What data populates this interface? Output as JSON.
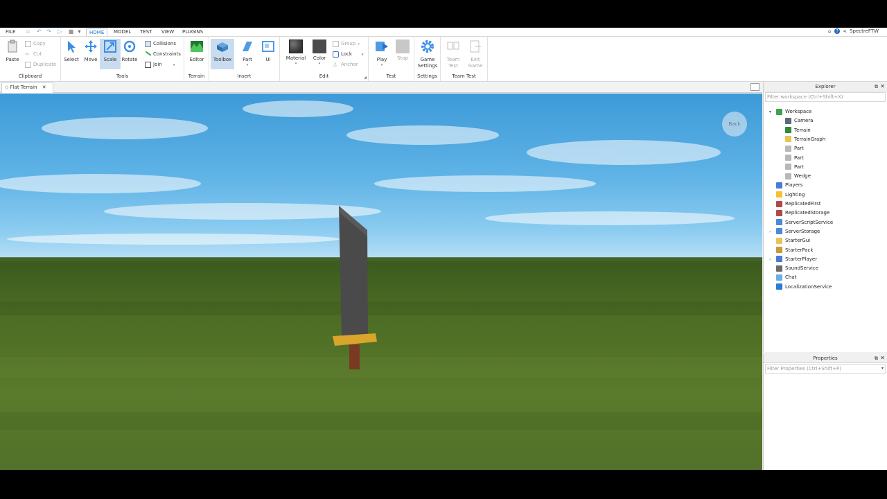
{
  "menu": {
    "tabs": [
      "FILE",
      "HOME",
      "MODEL",
      "TEST",
      "VIEW",
      "PLUGINS"
    ],
    "active_tab": "HOME",
    "user": "SpectreFTW"
  },
  "ribbon": {
    "clipboard": {
      "label": "Clipboard",
      "paste": "Paste",
      "copy": "Copy",
      "cut": "Cut",
      "duplicate": "Duplicate"
    },
    "tools": {
      "label": "Tools",
      "select": "Select",
      "move": "Move",
      "scale": "Scale",
      "rotate": "Rotate",
      "collisions": "Collisions",
      "constraints": "Constraints",
      "join": "Join"
    },
    "terrain": {
      "label": "Terrain",
      "editor": "Editor"
    },
    "insert": {
      "label": "Insert",
      "toolbox": "Toolbox",
      "part": "Part",
      "ui": "UI"
    },
    "edit": {
      "label": "Edit",
      "material": "Material",
      "color": "Color",
      "group": "Group",
      "lock": "Lock",
      "anchor": "Anchor"
    },
    "test": {
      "label": "Test",
      "play": "Play",
      "stop": "Stop"
    },
    "settings": {
      "label": "Settings",
      "game_settings_1": "Game",
      "game_settings_2": "Settings"
    },
    "team_test": {
      "label": "Team Test",
      "team_1": "Team",
      "team_2": "Test",
      "exit_1": "Exit",
      "exit_2": "Game"
    }
  },
  "document_tab": {
    "title": "Flat Terrain",
    "close": "✕"
  },
  "viewport": {
    "back_label": "Back"
  },
  "explorer": {
    "title": "Explorer",
    "filter_placeholder": "Filter workspace (Ctrl+Shift+X)",
    "items": [
      {
        "label": "Workspace",
        "icon": "workspace-icon",
        "color": "#3aa54a"
      },
      {
        "label": "Camera",
        "icon": "camera-icon",
        "color": "#5a6b7a"
      },
      {
        "label": "Terrain",
        "icon": "terrain-icon",
        "color": "#2e8b3a"
      },
      {
        "label": "TerrainGraph",
        "icon": "folder-icon",
        "color": "#e8c35a"
      },
      {
        "label": "Part",
        "icon": "part-icon",
        "color": "#b8b8b8"
      },
      {
        "label": "Part",
        "icon": "part-icon",
        "color": "#b8b8b8"
      },
      {
        "label": "Part",
        "icon": "part-icon",
        "color": "#b8b8b8"
      },
      {
        "label": "Wedge",
        "icon": "wedge-icon",
        "color": "#b8b8b8"
      },
      {
        "label": "Players",
        "icon": "players-icon",
        "color": "#4a7ad8"
      },
      {
        "label": "Lighting",
        "icon": "lighting-icon",
        "color": "#f2c230"
      },
      {
        "label": "ReplicatedFirst",
        "icon": "replicated-first-icon",
        "color": "#b04a4a"
      },
      {
        "label": "ReplicatedStorage",
        "icon": "replicated-storage-icon",
        "color": "#b04a4a"
      },
      {
        "label": "ServerScriptService",
        "icon": "server-script-service-icon",
        "color": "#4a8ad8"
      },
      {
        "label": "ServerStorage",
        "icon": "server-storage-icon",
        "color": "#4a8ad8"
      },
      {
        "label": "StarterGui",
        "icon": "starter-gui-icon",
        "color": "#e8c35a"
      },
      {
        "label": "StarterPack",
        "icon": "starter-pack-icon",
        "color": "#c89a3a"
      },
      {
        "label": "StarterPlayer",
        "icon": "starter-player-icon",
        "color": "#4a7ad8"
      },
      {
        "label": "SoundService",
        "icon": "sound-service-icon",
        "color": "#6a6a6a"
      },
      {
        "label": "Chat",
        "icon": "chat-icon",
        "color": "#6aaee8"
      },
      {
        "label": "LocalizationService",
        "icon": "localization-service-icon",
        "color": "#2a7ad8"
      }
    ]
  },
  "properties": {
    "title": "Properties",
    "filter_placeholder": "Filter Properties (Ctrl+Shift+P)"
  }
}
